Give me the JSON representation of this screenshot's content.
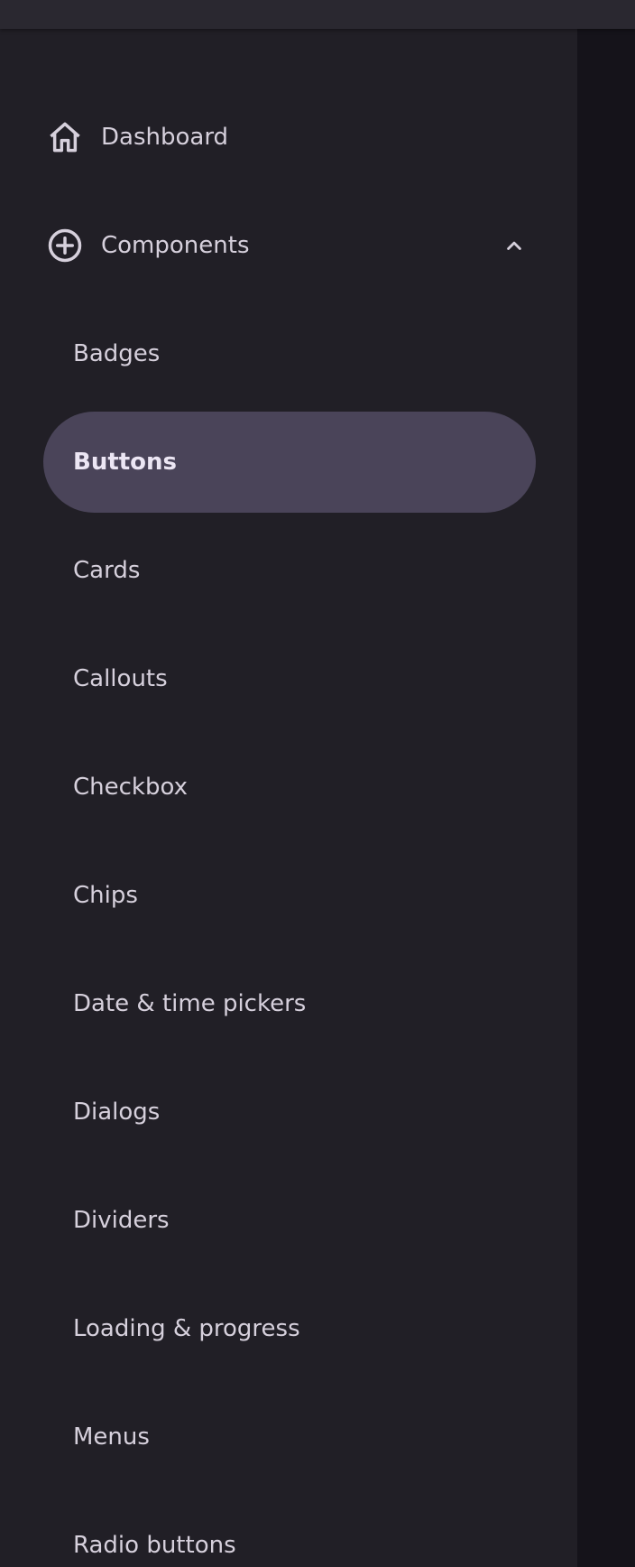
{
  "nav": {
    "dashboard": {
      "label": "Dashboard",
      "icon": "home-icon"
    },
    "components": {
      "label": "Components",
      "icon": "add-circle-icon",
      "expanded": true,
      "toggle_icon": "chevron-up-icon"
    },
    "items": [
      {
        "label": "Badges",
        "active": false
      },
      {
        "label": "Buttons",
        "active": true
      },
      {
        "label": "Cards",
        "active": false
      },
      {
        "label": "Callouts",
        "active": false
      },
      {
        "label": "Checkbox",
        "active": false
      },
      {
        "label": "Chips",
        "active": false
      },
      {
        "label": "Date & time pickers",
        "active": false
      },
      {
        "label": "Dialogs",
        "active": false
      },
      {
        "label": "Dividers",
        "active": false
      },
      {
        "label": "Loading & progress",
        "active": false
      },
      {
        "label": "Menus",
        "active": false
      },
      {
        "label": "Radio buttons",
        "active": false
      }
    ]
  },
  "colors": {
    "drawer_bg": "#211f26",
    "active_bg": "#4a4459",
    "text": "#d6d0dc",
    "active_text": "#ece6f4",
    "top_bar": "#2a2830",
    "scrim": "#15131a"
  }
}
